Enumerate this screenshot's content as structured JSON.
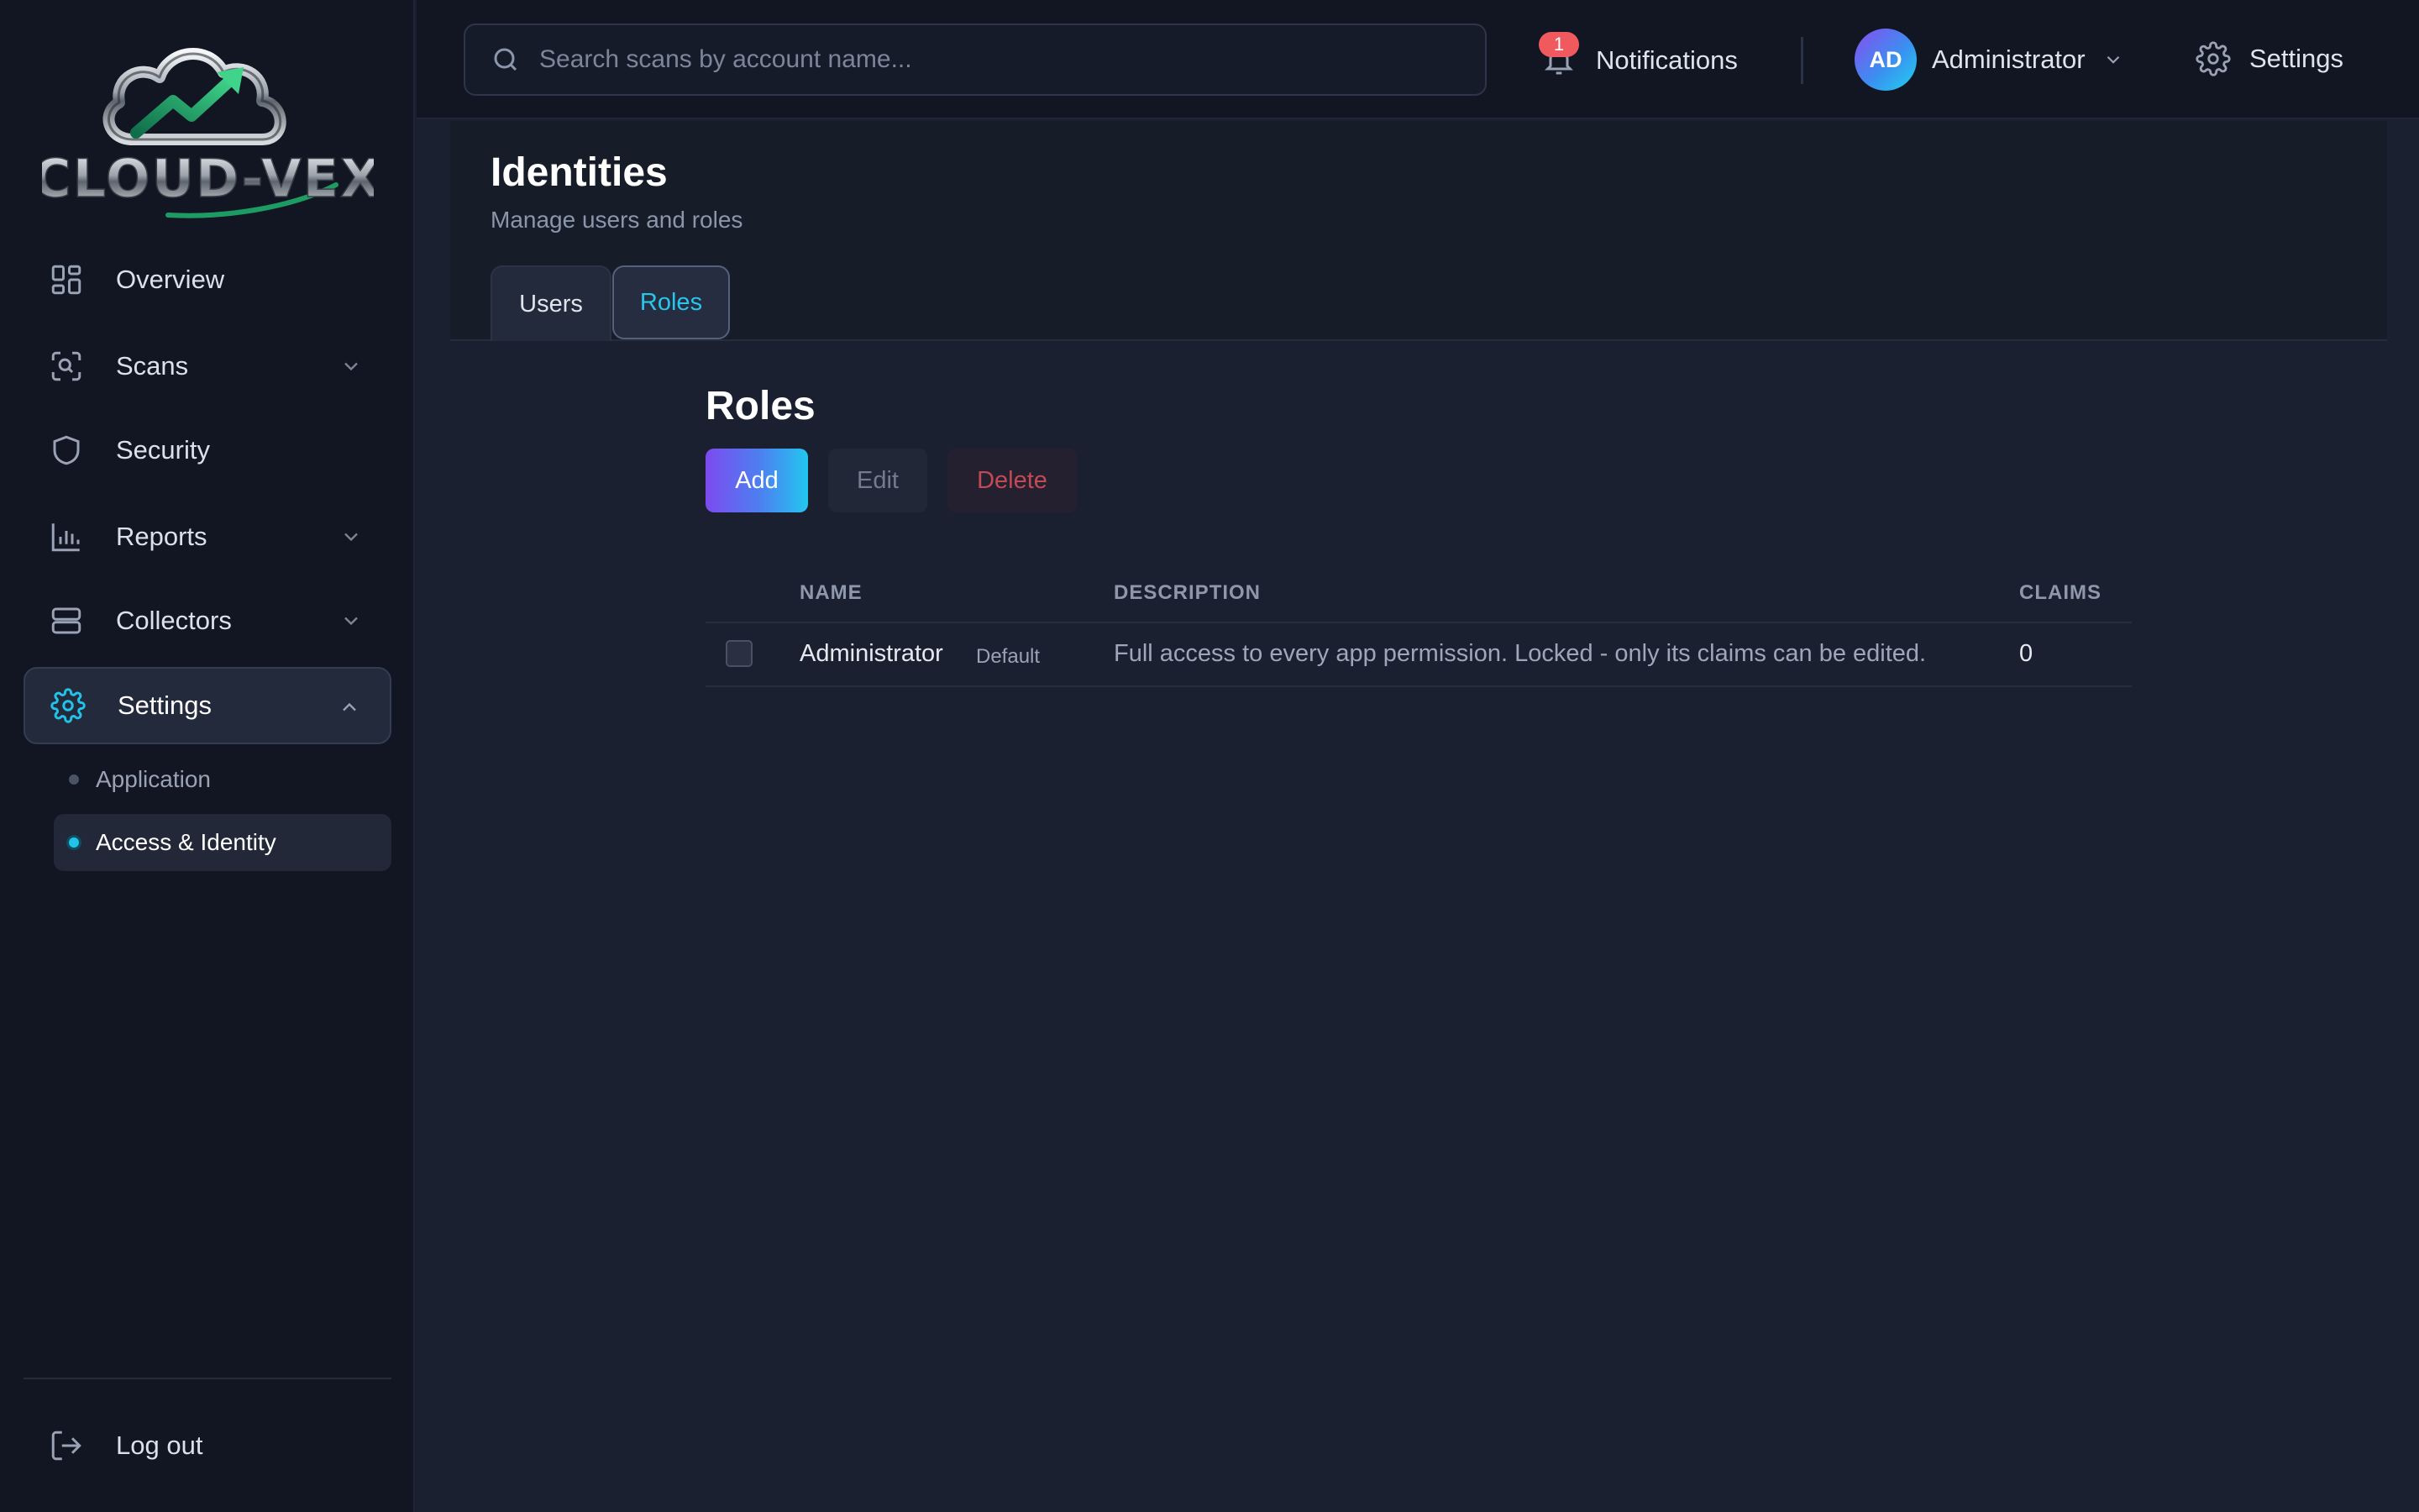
{
  "brand": {
    "logo_text": "CLOUD-VEX"
  },
  "sidebar": {
    "items": [
      {
        "label": "Overview",
        "icon": "grid-icon"
      },
      {
        "label": "Scans",
        "icon": "scan-icon",
        "expandable": true
      },
      {
        "label": "Security",
        "icon": "shield-icon"
      },
      {
        "label": "Reports",
        "icon": "bar-chart-icon",
        "expandable": true
      },
      {
        "label": "Collectors",
        "icon": "server-icon",
        "expandable": true
      },
      {
        "label": "Settings",
        "icon": "gear-icon",
        "expandable": true,
        "active": true
      }
    ],
    "settings_sub": [
      {
        "label": "Application"
      },
      {
        "label": "Access & Identity",
        "active": true
      }
    ],
    "logout_label": "Log out"
  },
  "topbar": {
    "search_placeholder": "Search scans by account name...",
    "notifications_label": "Notifications",
    "notifications_count": "1",
    "user_initials": "AD",
    "user_name": "Administrator",
    "settings_label": "Settings"
  },
  "page": {
    "title": "Identities",
    "subtitle": "Manage users and roles",
    "tabs": [
      {
        "label": "Users"
      },
      {
        "label": "Roles",
        "active": true
      }
    ]
  },
  "roles": {
    "title": "Roles",
    "add_label": "Add",
    "edit_label": "Edit",
    "delete_label": "Delete",
    "columns": [
      "NAME",
      "DESCRIPTION",
      "CLAIMS"
    ],
    "rows": [
      {
        "name": "Administrator",
        "tag": "Default",
        "description": "Full access to every app permission. Locked - only its claims can be edited.",
        "claims": "0"
      }
    ]
  },
  "colors": {
    "accent": "#22c3ea",
    "accent_purple": "#7d4af0",
    "danger": "#c24a55",
    "badge": "#f05a5e",
    "background": "#1b2030",
    "sidebar": "#111622"
  }
}
